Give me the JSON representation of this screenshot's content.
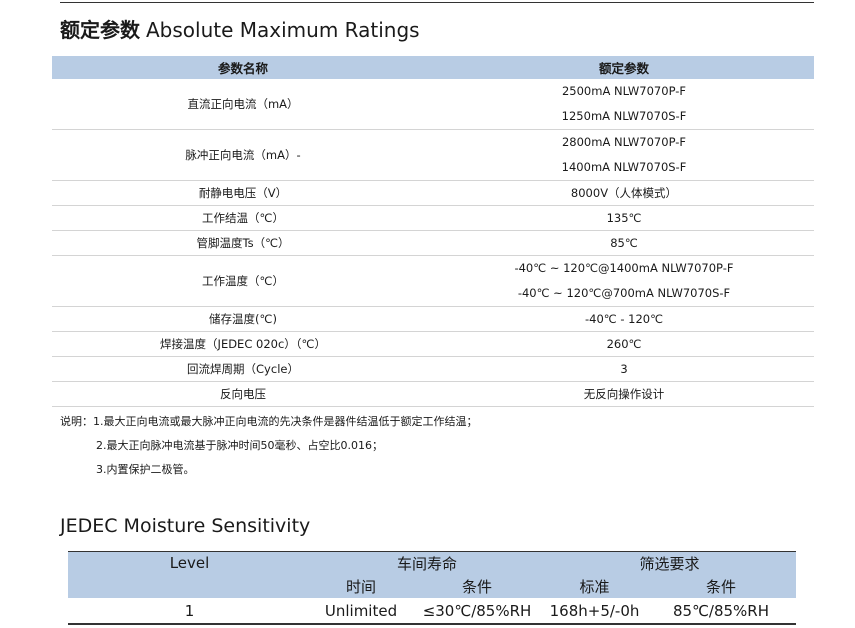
{
  "abs": {
    "title_cn": "额定参数",
    "title_en": "Absolute Maximum Ratings",
    "header": {
      "param": "参数名称",
      "value": "额定参数"
    },
    "rows": [
      {
        "name": "直流正向电流（mA）",
        "values": [
          "2500mA NLW7070P-F",
          "1250mA NLW7070S-F"
        ]
      },
      {
        "name": "脉冲正向电流（mA）-",
        "values": [
          "2800mA NLW7070P-F",
          "1400mA NLW7070S-F"
        ]
      },
      {
        "name": "耐静电电压（V）",
        "values": [
          "8000V（人体模式）"
        ]
      },
      {
        "name": "工作结温（℃）",
        "values": [
          "135℃"
        ]
      },
      {
        "name": "管脚温度Ts（℃）",
        "values": [
          "85℃"
        ]
      },
      {
        "name": "工作温度（℃）",
        "values": [
          "-40℃ ~ 120℃@1400mA NLW7070P-F",
          "-40℃ ~ 120℃@700mA NLW7070S-F"
        ]
      },
      {
        "name": "储存温度(℃)",
        "values": [
          "-40℃ - 120℃"
        ]
      },
      {
        "name": "焊接温度（JEDEC 020c）（℃）",
        "values": [
          "260℃"
        ]
      },
      {
        "name": "回流焊周期（Cycle）",
        "values": [
          "3"
        ]
      },
      {
        "name": "反向电压",
        "values": [
          "无反向操作设计"
        ]
      }
    ]
  },
  "notes": {
    "label": "说明：",
    "items": [
      "1.最大正向电流或最大脉冲正向电流的先决条件是器件结温低于额定工作结温；",
      "2.最大正向脉冲电流基于脉冲时间50毫秒、占空比0.016；",
      "3.内置保护二极管。"
    ]
  },
  "jedec": {
    "title": "JEDEC Moisture Sensitivity",
    "headers": {
      "level": "Level",
      "floor_life": "车间寿命",
      "screening": "筛选要求",
      "time": "时间",
      "condition1": "条件",
      "standard": "标准",
      "condition2": "条件"
    },
    "row": {
      "level": "1",
      "time": "Unlimited",
      "condition1": "≤30℃/85%RH",
      "standard": "168h+5/-0h",
      "condition2": "85℃/85%RH"
    }
  }
}
